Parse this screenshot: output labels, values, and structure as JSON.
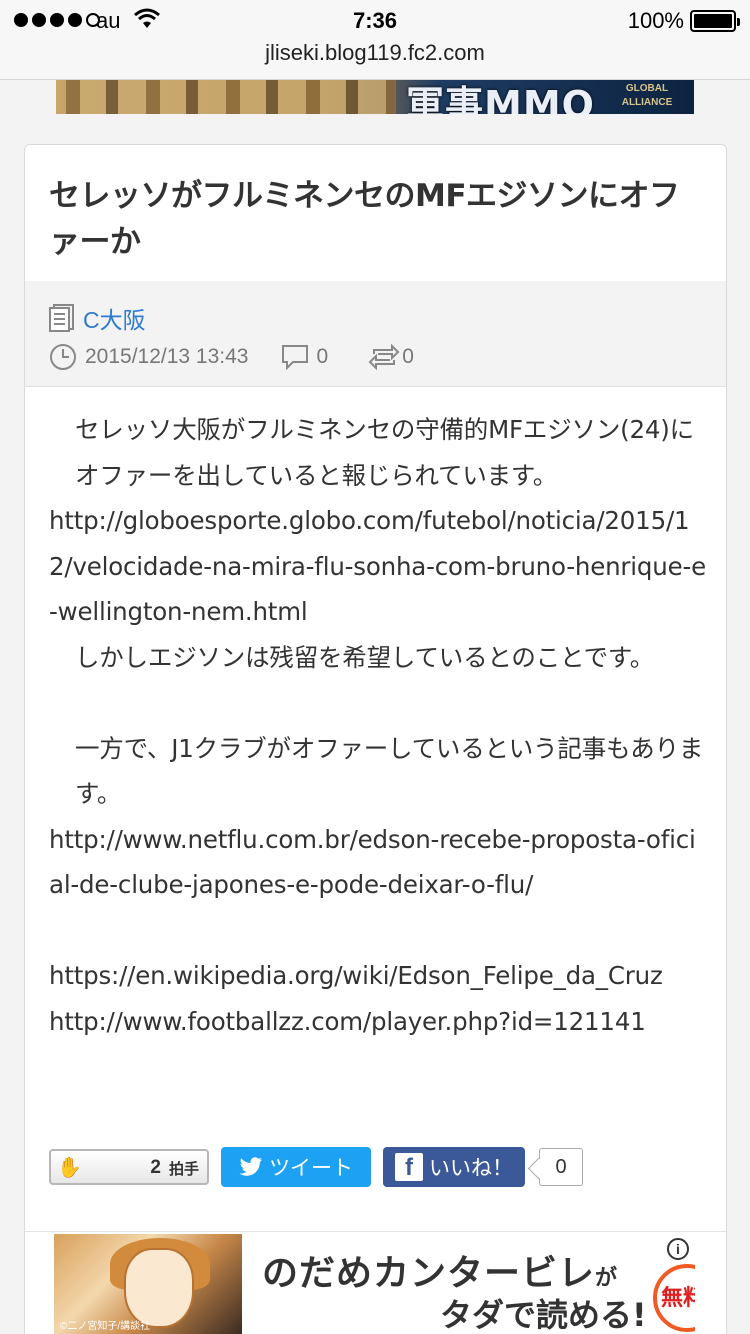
{
  "status_bar": {
    "carrier": "au",
    "time": "7:36",
    "battery_percent": "100%",
    "signal_bars_filled": 4,
    "signal_bars_total": 5,
    "url": "jliseki.blog119.fc2.com"
  },
  "top_ad": {
    "text": "軍事MMO",
    "small_text": "GLOBAL ALLIANCE"
  },
  "article": {
    "title": "セレッソがフルミネンセのMFエジソンにオファーか",
    "category": "C大阪",
    "date": "2015/12/13 13:43",
    "comment_count": "0",
    "trackback_count": "0",
    "paragraphs": [
      "セレッソ大阪がフルミネンセの守備的MFエジソン(24)にオファーを出していると報じられています。",
      "http://globoesporte.globo.com/futebol/noticia/2015/12/velocidade-na-mira-flu-sonha-com-bruno-henrique-e-wellington-nem.html",
      "しかしエジソンは残留を希望しているとのことです。",
      "",
      "一方で、J1クラブがオファーしているという記事もあります。",
      "http://www.netflu.com.br/edson-recebe-proposta-oficial-de-clube-japones-e-pode-deixar-o-flu/",
      "",
      "https://en.wikipedia.org/wiki/Edson_Felipe_da_Cruz",
      "http://www.footballzz.com/player.php?id=121141"
    ]
  },
  "share": {
    "clap_count": "2",
    "clap_label": "拍手",
    "tweet_label": "ツイート",
    "like_label": "いいね！",
    "like_count": "0"
  },
  "bottom_ad": {
    "title": "のだめカンタービレ",
    "title_suffix": "が",
    "subtitle": "タダで読める!",
    "badge": "無料",
    "copyright": "©二ノ宮知子/講談社"
  },
  "colors": {
    "link": "#2d7bd0",
    "twitter": "#1da1f2",
    "facebook": "#3b5998"
  }
}
